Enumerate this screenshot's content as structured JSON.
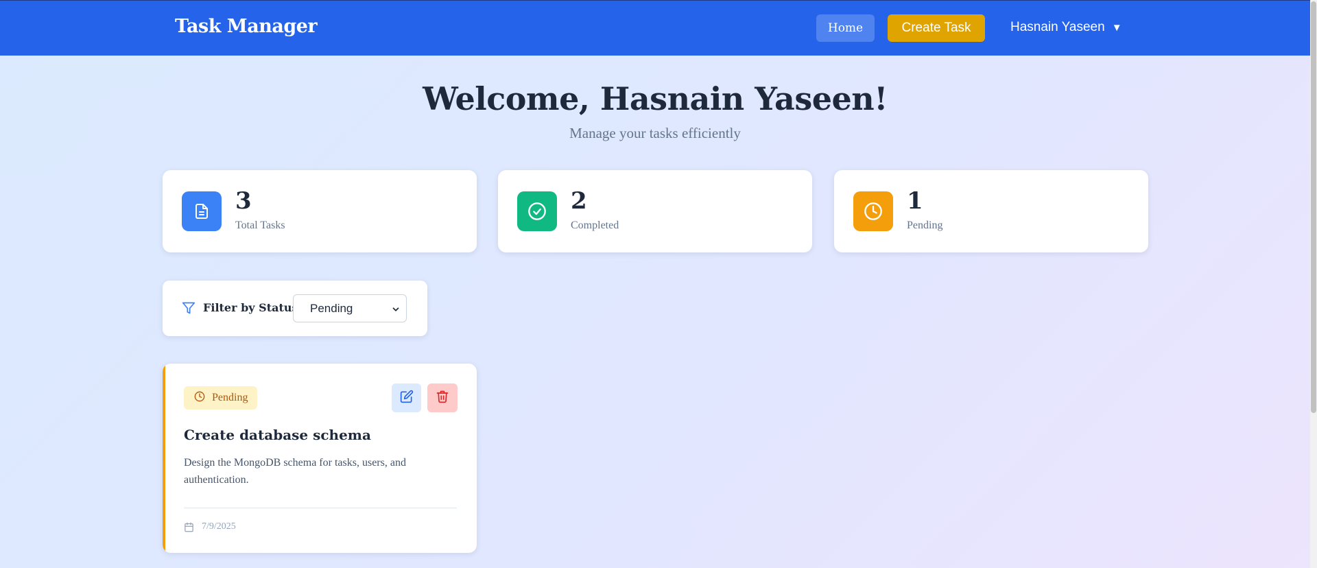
{
  "navbar": {
    "brand": "Task Manager",
    "home_label": "Home",
    "create_label": "Create Task",
    "user_name": "Hasnain Yaseen",
    "caret": "▼"
  },
  "header": {
    "title": "Welcome, Hasnain Yaseen!",
    "subtitle": "Manage your tasks efficiently"
  },
  "stats": [
    {
      "value": "3",
      "label": "Total Tasks",
      "icon": "document-icon",
      "color": "#3b82f6"
    },
    {
      "value": "2",
      "label": "Completed",
      "icon": "check-circle-icon",
      "color": "#10b981"
    },
    {
      "value": "1",
      "label": "Pending",
      "icon": "clock-icon",
      "color": "#f59e0b"
    }
  ],
  "filter": {
    "label": "Filter by Status",
    "selected": "Pending",
    "icon": "filter-icon"
  },
  "tasks": [
    {
      "status": "Pending",
      "title": "Create database schema",
      "description": "Design the MongoDB schema for tasks, users, and authentication.",
      "date": "7/9/2025",
      "accent_color": "#f59e0b"
    }
  ],
  "colors": {
    "primary": "#2563eb",
    "accent": "#e0a400",
    "pending": "#f59e0b",
    "completed": "#10b981"
  }
}
